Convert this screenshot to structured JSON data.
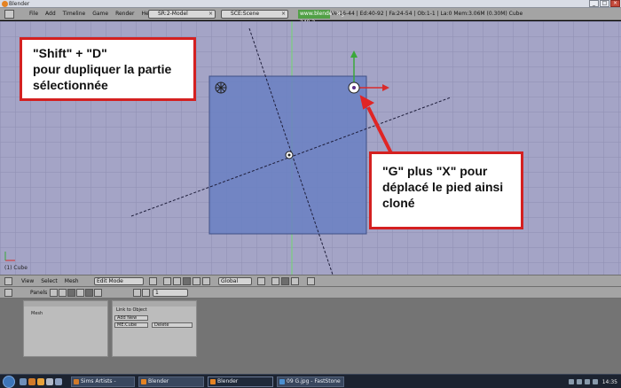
{
  "window": {
    "title": "Blender",
    "buttons": [
      "_",
      "□",
      "×"
    ]
  },
  "infobar": {
    "menus": [
      "File",
      "Add",
      "Timeline",
      "Game",
      "Render",
      "Help"
    ],
    "screen_field": "SR:2-Model",
    "scene_field": "SCE:Scene",
    "url": "www.blender.org 249.2",
    "stats": "Ve:16-44 | Ed:40-92 | Fa:24-54 | Ob:1-1 | La:0  Mem:3.06M (0.30M) Cube"
  },
  "viewport": {
    "callout_1": [
      "\"Shift\" + \"D\"",
      "pour dupliquer la partie",
      "sélectionnée"
    ],
    "callout_2": [
      "\"G\" plus \"X\" pour",
      "déplacé le pied ainsi",
      "cloné"
    ],
    "object_label": "(1) Cube"
  },
  "view_header": {
    "menus": [
      "View",
      "Select",
      "Mesh"
    ],
    "mode": "Edit Mode",
    "orientation": "Global"
  },
  "buttons_window": {
    "header_label": "Panels",
    "panel_1_title": "Mesh",
    "panel_2_rows": [
      "Link to Object",
      "Add New",
      "ME:Cube",
      "Delete"
    ],
    "page_value": "1"
  },
  "taskbar": {
    "tasks": [
      "Sims Artists - Mozill...",
      "Blender",
      "Blender",
      "09 G.jpg - FastStone"
    ],
    "clock": "14:35"
  },
  "colors": {
    "viewport_bg": "#a4a4c6",
    "mesh_face": "#6a80c2",
    "callout_border": "#d42020",
    "arrow": "#e02525",
    "axis_x": "#d92b2b",
    "axis_y": "#3aa83a"
  }
}
